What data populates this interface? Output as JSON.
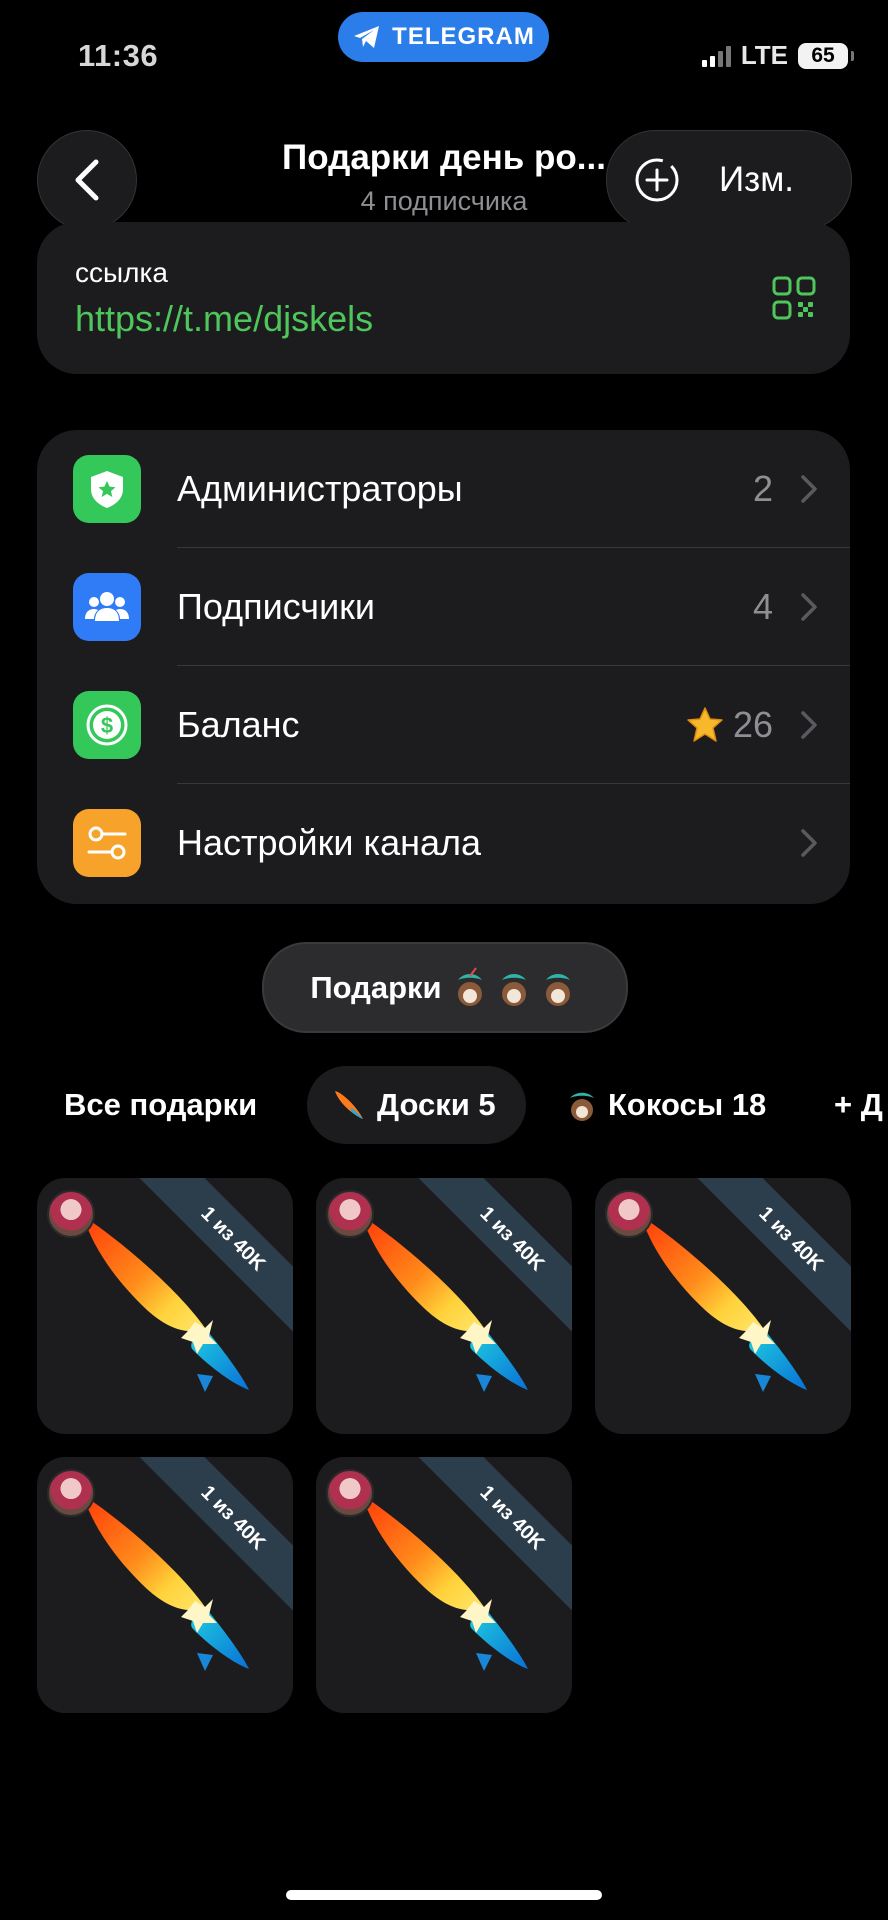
{
  "status_bar": {
    "time": "11:36",
    "app_pill": "TELEGRAM",
    "network": "LTE",
    "battery": "65"
  },
  "header": {
    "title": "Подарки день ро...",
    "subtitle": "4 подписчика",
    "edit_label": "Изм."
  },
  "link_card": {
    "caption": "ссылка",
    "url": "https://t.me/djskels"
  },
  "menu": [
    {
      "label": "Администраторы",
      "value": "2",
      "icon": "shield-star-icon",
      "color": "#34c759"
    },
    {
      "label": "Подписчики",
      "value": "4",
      "icon": "people-icon",
      "color": "#2f7cf6"
    },
    {
      "label": "Баланс",
      "value": "26",
      "icon": "dollar-coin-icon",
      "color": "#34c759"
    },
    {
      "label": "Настройки канала",
      "value": "",
      "icon": "toggles-icon",
      "color": "#f7a32b"
    }
  ],
  "gifts_pill": {
    "label": "Подарки"
  },
  "tabs": [
    {
      "label": "Все подарки",
      "active": false
    },
    {
      "label": "Доски 5",
      "active": true
    },
    {
      "label": "Кокосы 18",
      "active": false
    },
    {
      "label": "+ Д",
      "active": false
    }
  ],
  "gifts": [
    {
      "badge": "1 из 40K"
    },
    {
      "badge": "1 из 40K"
    },
    {
      "badge": "1 из 40K"
    },
    {
      "badge": "1 из 40K"
    },
    {
      "badge": "1 из 40K"
    }
  ],
  "colors": {
    "accent_blue": "#2b7de9",
    "link_green": "#4fc65c",
    "card_bg": "#1c1c1e"
  }
}
